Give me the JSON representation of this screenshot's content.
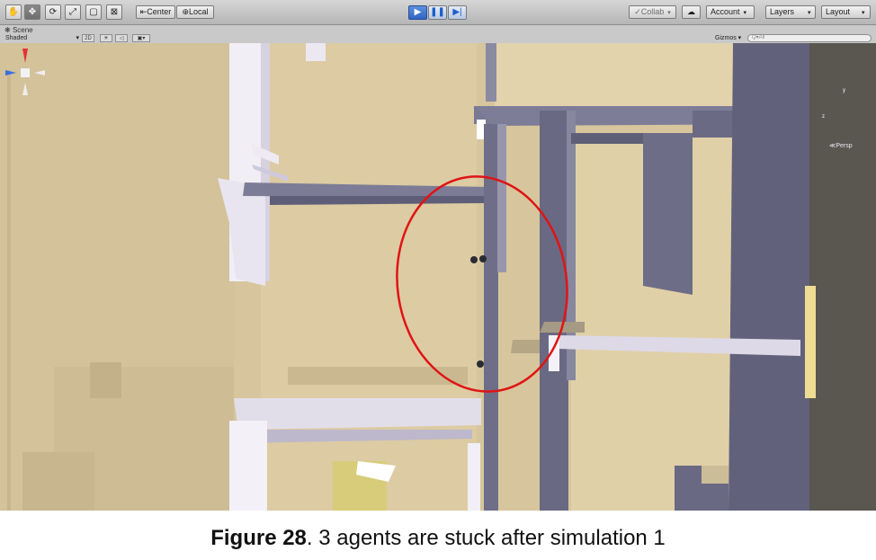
{
  "toolbar": {
    "tools": [
      "hand-icon",
      "move-icon",
      "rotate-icon",
      "scale-icon",
      "rect-icon",
      "transform-icon"
    ],
    "pivot_center": "Center",
    "pivot_local": "Local",
    "collab": "Collab",
    "account": "Account",
    "layers": "Layers",
    "layout": "Layout"
  },
  "scene": {
    "tab_label": "Scene",
    "shading": "Shaded",
    "mode_2d": "2D",
    "gizmos": "Gizmos",
    "search_placeholder": "Q▾All",
    "persp_label": "Persp",
    "gizmo_axis_y": "y",
    "gizmo_axis_z": "z"
  },
  "colors": {
    "floor": "#d9c89e",
    "wall_dark": "#6c6b84",
    "highlight_circle": "#e01414"
  },
  "annotation": {
    "highlighted_agents": 3
  },
  "caption": {
    "label": "Figure 28",
    "text": ". 3 agents are stuck after simulation 1"
  }
}
